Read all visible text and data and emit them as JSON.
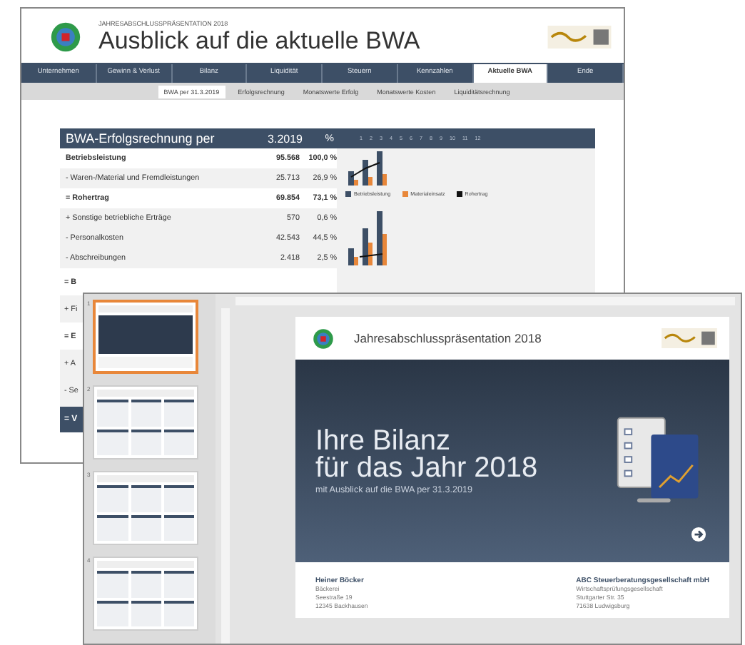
{
  "back_window": {
    "kicker": "JAHRESABSCHLUSSPRÄSENTATION 2018",
    "title": "Ausblick auf die aktuelle BWA",
    "tabs": [
      {
        "label": "Unternehmen",
        "selected": false
      },
      {
        "label": "Gewinn & Verlust",
        "selected": false
      },
      {
        "label": "Bilanz",
        "selected": false
      },
      {
        "label": "Liquidität",
        "selected": false
      },
      {
        "label": "Steuern",
        "selected": false
      },
      {
        "label": "Kennzahlen",
        "selected": false
      },
      {
        "label": "Aktuelle BWA",
        "selected": true
      },
      {
        "label": "Ende",
        "selected": false
      }
    ],
    "subtabs": [
      {
        "label": "BWA per 31.3.2019",
        "selected": true
      },
      {
        "label": "Erfolgsrechnung",
        "selected": false
      },
      {
        "label": "Monatswerte Erfolg",
        "selected": false
      },
      {
        "label": "Monatswerte Kosten",
        "selected": false
      },
      {
        "label": "Liquiditätsrechnung",
        "selected": false
      }
    ],
    "table": {
      "title": "BWA-Erfolgsrechnung per",
      "period": "3.2019",
      "percent": "%",
      "months": [
        "1",
        "2",
        "3",
        "4",
        "5",
        "6",
        "7",
        "8",
        "9",
        "10",
        "11",
        "12"
      ],
      "rows": [
        {
          "label": "Betriebsleistung",
          "value": "95.568",
          "share": "100,0 %",
          "bold": true
        },
        {
          "label": "- Waren-/Material und Fremdleistungen",
          "value": "25.713",
          "share": "26,9 %",
          "bold": false
        },
        {
          "label": "= Rohertrag",
          "value": "69.854",
          "share": "73,1 %",
          "bold": true
        },
        {
          "label": "+ Sonstige betriebliche Erträge",
          "value": "570",
          "share": "0,6 %",
          "bold": false
        },
        {
          "label": "- Personalkosten",
          "value": "42.543",
          "share": "44,5 %",
          "bold": false
        },
        {
          "label": "- Abschreibungen",
          "value": "2.418",
          "share": "2,5 %",
          "bold": false
        }
      ],
      "cut_rows": [
        {
          "label": "= B",
          "bold": true
        },
        {
          "label": "+ Fi",
          "bold": false
        },
        {
          "label": "= E",
          "bold": true
        },
        {
          "label": "+ A",
          "bold": false
        },
        {
          "label": "- Se",
          "bold": false
        }
      ],
      "last_row": "= V"
    },
    "legend": [
      {
        "label": "Betriebsleistung",
        "color": "#3d4f66"
      },
      {
        "label": "Materialeinsatz",
        "color": "#e8873a"
      },
      {
        "label": "Rohertrag",
        "color": "#111111"
      }
    ]
  },
  "front_window": {
    "thumbnails": [
      {
        "number": "1",
        "kind": "title",
        "selected": true
      },
      {
        "number": "2",
        "kind": "tables",
        "selected": false
      },
      {
        "number": "3",
        "kind": "tables",
        "selected": false
      },
      {
        "number": "4",
        "kind": "tables",
        "selected": false
      }
    ],
    "slide": {
      "header": "Jahresabschlusspräsentation 2018",
      "headline_1": "Ihre Bilanz",
      "headline_2": "für das Jahr 2018",
      "subline": "mit Ausblick auf die BWA per 31.3.2019",
      "left_contact": [
        "Heiner Böcker",
        "Bäckerei",
        "Seestraße 19",
        "12345 Backhausen"
      ],
      "right_contact": [
        "ABC Steuerberatungsgesellschaft mbH",
        "Wirtschaftsprüfungsgesellschaft",
        "Stuttgarter Str. 35",
        "71638 Ludwigsburg"
      ]
    }
  }
}
